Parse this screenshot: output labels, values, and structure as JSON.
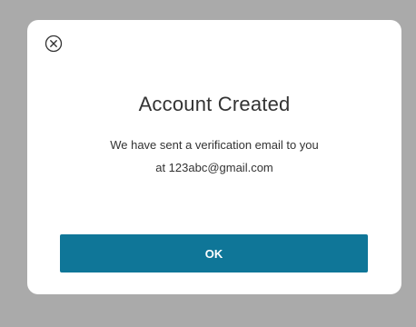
{
  "dialog": {
    "close_icon": "close-circle-icon",
    "title": "Account Created",
    "message_line1": "We have sent a verification email to you",
    "message_line2": "at 123abc@gmail.com",
    "ok_label": "OK"
  },
  "colors": {
    "backdrop": "#aaaaaa",
    "dialog_background": "#ffffff",
    "button_background": "#0f7698",
    "button_text": "#ffffff",
    "text": "#333333"
  }
}
